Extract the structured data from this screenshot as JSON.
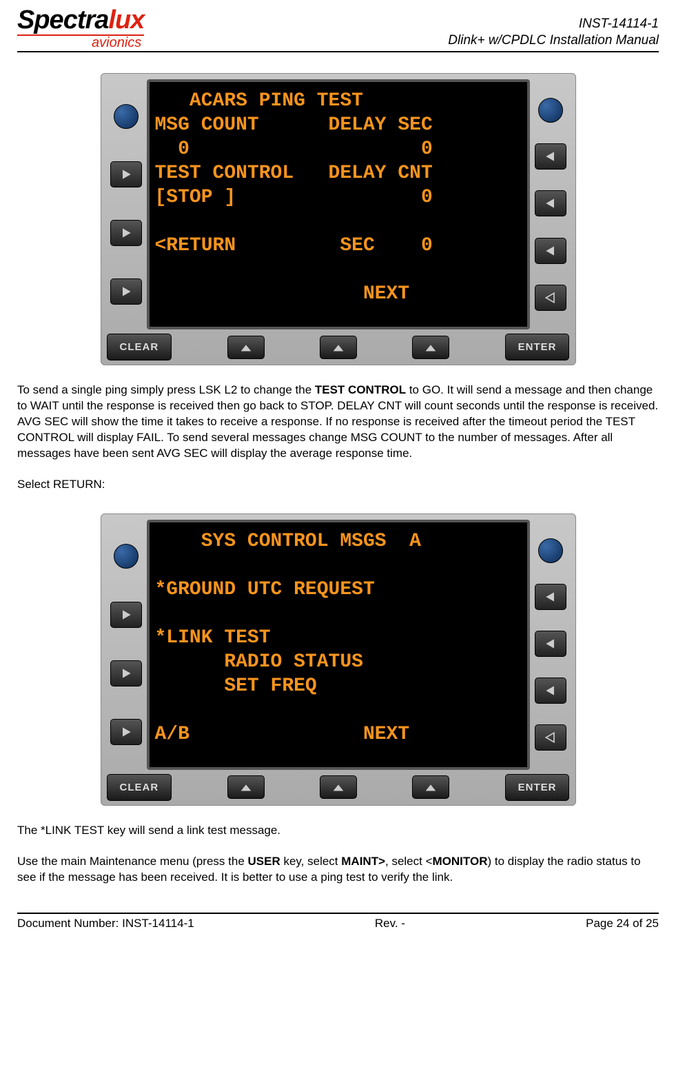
{
  "header": {
    "logo_part1": "Spectra",
    "logo_part2": "lux",
    "logo_sub": "avionics",
    "doc_id": "INST-14114-1",
    "title": "Dlink+ w/CPDLC Installation Manual"
  },
  "cdu1": {
    "screen": "   ACARS PING TEST\nMSG COUNT      DELAY SEC\n  0                    0\nTEST CONTROL   DELAY CNT\n[STOP ]                0\n\n<RETURN         SEC    0\n\n                  NEXT",
    "clear": "CLEAR",
    "enter": "ENTER"
  },
  "paragraphs": {
    "p1_a": "To send a single ping simply press LSK L2 to change the ",
    "p1_b": "TEST CONTROL",
    "p1_c": " to GO.  It will send a message and then change to WAIT until the response is received then go back to STOP.  DELAY CNT will count seconds until the response is received.  AVG SEC will show the time it takes to receive a response.  If no response is received after the timeout period the TEST CONTROL will display FAIL.  To send several messages change MSG COUNT to the number of messages.  After all messages have been sent AVG SEC will display the average response time.",
    "p2": "Select RETURN:"
  },
  "cdu2": {
    "screen": "    SYS CONTROL MSGS  A\n\n*GROUND UTC REQUEST\n\n*LINK TEST\n      RADIO STATUS\n      SET FREQ\n\nA/B               NEXT",
    "clear": "CLEAR",
    "enter": "ENTER"
  },
  "paragraphs2": {
    "p3": "The *LINK TEST key will send a link test message.",
    "p4_a": "Use the main Maintenance menu (press the ",
    "p4_b": "USER",
    "p4_c": " key, select ",
    "p4_d": "MAINT>",
    "p4_e": ", select <",
    "p4_f": "MONITOR",
    "p4_g": ") to display the radio status to see if the message has been received.  It is better to use a ping test to verify the link."
  },
  "footer": {
    "left": "Document Number:  INST-14114-1",
    "center": "Rev. -",
    "right": "Page 24 of 25"
  }
}
